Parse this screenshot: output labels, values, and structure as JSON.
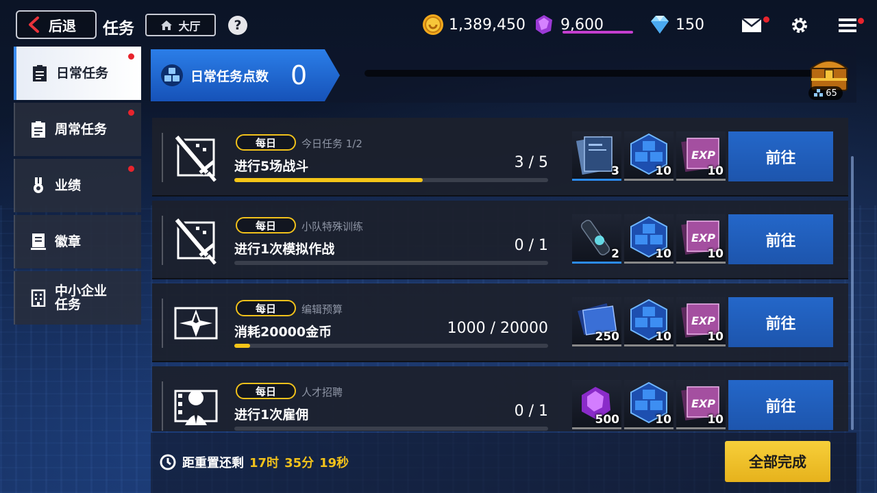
{
  "header": {
    "back_label": "后退",
    "title": "任务",
    "lobby_label": "大厅",
    "help_label": "?",
    "gold": "1,389,450",
    "crystal": "9,600",
    "diamond": "150",
    "icons": [
      "coin-icon",
      "crystal-icon",
      "diamond-icon",
      "mail-icon",
      "gear-icon",
      "menu-icon"
    ]
  },
  "sidebar": {
    "items": [
      {
        "label": "日常任务",
        "active": true,
        "alert": true,
        "icon": "clipboard-icon"
      },
      {
        "label": "周常任务",
        "active": false,
        "alert": true,
        "icon": "clipboard-icon"
      },
      {
        "label": "业绩",
        "active": false,
        "alert": true,
        "icon": "medal-icon"
      },
      {
        "label": "徽章",
        "active": false,
        "alert": false,
        "icon": "badge-icon"
      },
      {
        "label": "中小企业任务",
        "active": false,
        "alert": false,
        "icon": "building-icon"
      }
    ]
  },
  "points": {
    "label": "日常任务点数",
    "value": "0",
    "progress": 0,
    "chest_count": "65"
  },
  "tasks": [
    {
      "tag": "每日",
      "category": "今日任务  1/2",
      "name": "进行5场战斗",
      "count": "3 / 5",
      "progress": 0.6,
      "icon": "sword-icon",
      "rewards": [
        {
          "icon": "document-folder-icon",
          "qty": "3",
          "highlight": true
        },
        {
          "icon": "blue-cube-icon",
          "qty": "10",
          "highlight": false
        },
        {
          "icon": "exp-book-icon",
          "qty": "10",
          "highlight": false
        }
      ],
      "button": "前往"
    },
    {
      "tag": "每日",
      "category": "小队特殊训练",
      "name": "进行1次模拟作战",
      "count": "0 / 1",
      "progress": 0,
      "icon": "sword-icon",
      "rewards": [
        {
          "icon": "tube-icon",
          "qty": "2",
          "highlight": true
        },
        {
          "icon": "blue-cube-icon",
          "qty": "10",
          "highlight": false
        },
        {
          "icon": "exp-book-icon",
          "qty": "10",
          "highlight": false
        }
      ],
      "button": "前往"
    },
    {
      "tag": "每日",
      "category": "编辑预算",
      "name": "消耗20000金币",
      "count": "1000 / 20000",
      "progress": 0.05,
      "icon": "star-envelope-icon",
      "rewards": [
        {
          "icon": "blue-book-icon",
          "qty": "250",
          "highlight": false
        },
        {
          "icon": "blue-cube-icon",
          "qty": "10",
          "highlight": false
        },
        {
          "icon": "exp-book-icon",
          "qty": "10",
          "highlight": false
        }
      ],
      "button": "前往"
    },
    {
      "tag": "每日",
      "category": "人才招聘",
      "name": "进行1次雇佣",
      "count": "0 / 1",
      "progress": 0,
      "icon": "person-card-icon",
      "rewards": [
        {
          "icon": "purple-crystal-icon",
          "qty": "500",
          "highlight": false
        },
        {
          "icon": "blue-cube-icon",
          "qty": "10",
          "highlight": false
        },
        {
          "icon": "exp-book-icon",
          "qty": "10",
          "highlight": false
        }
      ],
      "button": "前往"
    }
  ],
  "footer": {
    "reset_label": "距重置还剩",
    "hours": "17时",
    "minutes": "35分",
    "seconds": "19秒",
    "complete_all": "全部完成"
  },
  "colors": {
    "accent_blue": "#2467c9",
    "gold": "#f5c518",
    "alert_red": "#e8242d",
    "crystal_purple": "#c43ecf"
  }
}
